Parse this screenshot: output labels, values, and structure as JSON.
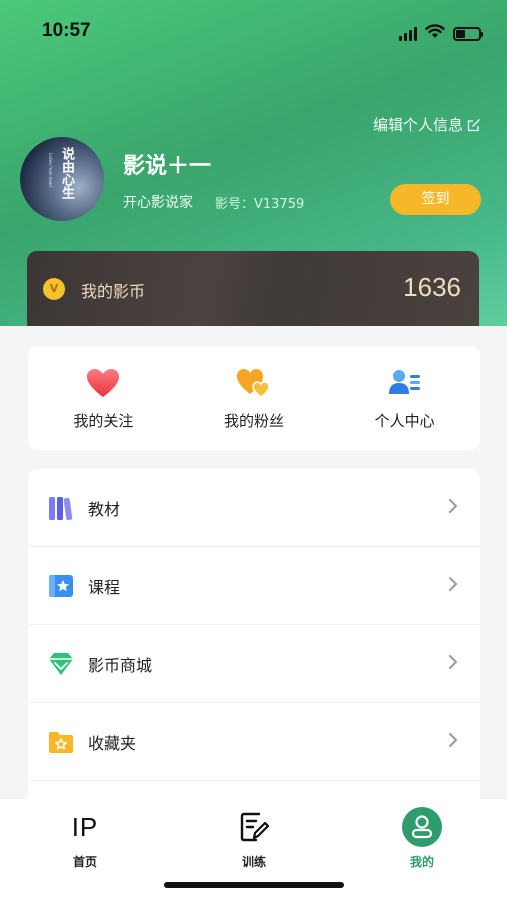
{
  "status_bar": {
    "time": "10:57"
  },
  "profile": {
    "edit_label": "编辑个人信息",
    "avatar_text": "说由心生",
    "avatar_subtext": "Listen from heart",
    "username": "影说＋一",
    "subtitle": "开心影说家",
    "user_id": "影号：V13759",
    "checkin_label": "签到"
  },
  "coins": {
    "icon_letter": "V",
    "label": "我的影币",
    "value": "1636"
  },
  "quick_actions": [
    {
      "label": "我的关注",
      "icon": "heart-icon",
      "color": "#f0464f"
    },
    {
      "label": "我的粉丝",
      "icon": "fans-heart-icon",
      "color": "#f6a623"
    },
    {
      "label": "个人中心",
      "icon": "personal-center-icon",
      "color": "#3a8ef0"
    }
  ],
  "menu": [
    {
      "label": "教材",
      "icon": "books-icon",
      "color": "#6b6cf0"
    },
    {
      "label": "课程",
      "icon": "course-star-icon",
      "color": "#3a8ef0"
    },
    {
      "label": "影币商城",
      "icon": "diamond-icon",
      "color": "#2fc27a"
    },
    {
      "label": "收藏夹",
      "icon": "folder-star-icon",
      "color": "#f6b829"
    }
  ],
  "tabs": [
    {
      "label": "首页",
      "icon": "IP",
      "active": false
    },
    {
      "label": "训练",
      "icon": "edit-doc-icon",
      "active": false
    },
    {
      "label": "我的",
      "icon": "user-icon",
      "active": true
    }
  ],
  "colors": {
    "accent": "#2e9c6c",
    "checkin": "#f6b829",
    "coin_text": "#f0dcbf"
  }
}
